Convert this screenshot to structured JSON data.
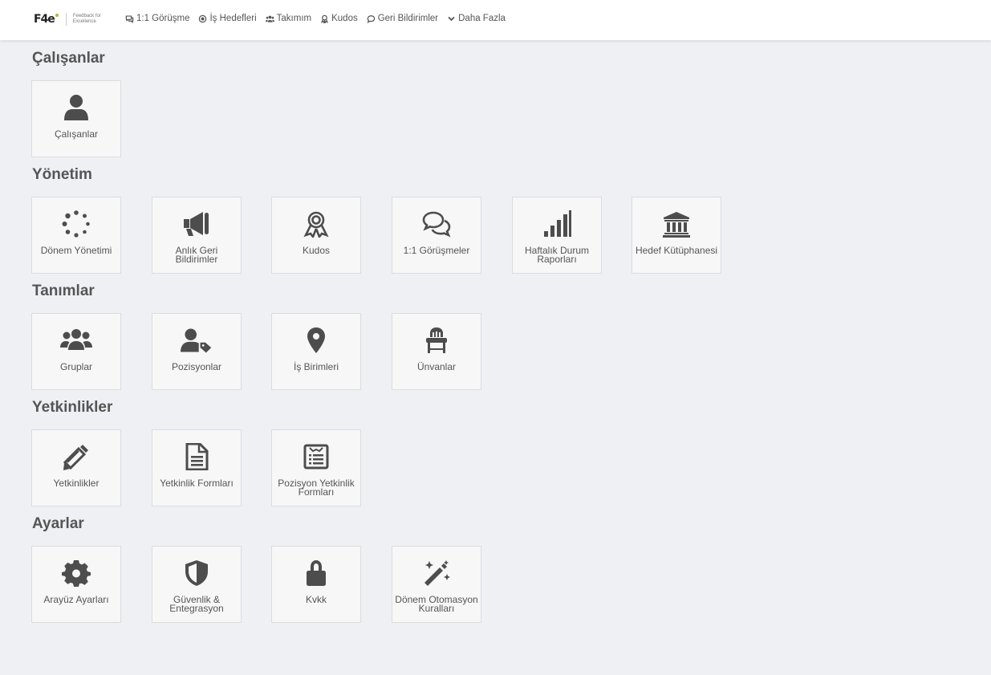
{
  "header": {
    "logo_text": "F4e",
    "logo_subtitle": "Feedback for Excellence",
    "nav": [
      {
        "label": "1:1 Görüşme",
        "icon": "chat-icon"
      },
      {
        "label": "İş Hedefleri",
        "icon": "target-icon"
      },
      {
        "label": "Takımım",
        "icon": "team-icon"
      },
      {
        "label": "Kudos",
        "icon": "award-icon"
      },
      {
        "label": "Geri Bildirimler",
        "icon": "comment-icon"
      },
      {
        "label": "Daha Fazla",
        "icon": "chevron-down-icon"
      }
    ]
  },
  "sections": [
    {
      "title": "Çalışanlar",
      "items": [
        {
          "label": "Çalışanlar",
          "icon": "user-icon"
        }
      ]
    },
    {
      "title": "Yönetim",
      "items": [
        {
          "label": "Dönem Yönetimi",
          "icon": "spinner-icon"
        },
        {
          "label": "Anlık Geri Bildirimler",
          "icon": "megaphone-icon"
        },
        {
          "label": "Kudos",
          "icon": "award-icon"
        },
        {
          "label": "1:1 Görüşmeler",
          "icon": "comments-icon"
        },
        {
          "label": "Haftalık Durum Raporları",
          "icon": "signal-bars-icon"
        },
        {
          "label": "Hedef Kütüphanesi",
          "icon": "library-icon"
        }
      ]
    },
    {
      "title": "Tanımlar",
      "items": [
        {
          "label": "Gruplar",
          "icon": "users-icon"
        },
        {
          "label": "Pozisyonlar",
          "icon": "user-tag-icon"
        },
        {
          "label": "İş Birimleri",
          "icon": "map-marker-icon"
        },
        {
          "label": "Ünvanlar",
          "icon": "chair-icon"
        }
      ]
    },
    {
      "title": "Yetkinlikler",
      "items": [
        {
          "label": "Yetkinlikler",
          "icon": "pencil-icon"
        },
        {
          "label": "Yetkinlik Formları",
          "icon": "file-icon"
        },
        {
          "label": "Pozisyon Yetkinlik Formları",
          "icon": "form-list-icon"
        }
      ]
    },
    {
      "title": "Ayarlar",
      "items": [
        {
          "label": "Arayüz Ayarları",
          "icon": "gear-icon"
        },
        {
          "label": "Güvenlik & Entegrasyon",
          "icon": "shield-icon"
        },
        {
          "label": "Kvkk",
          "icon": "lock-icon"
        },
        {
          "label": "Dönem Otomasyon Kuralları",
          "icon": "magic-wand-icon"
        }
      ]
    }
  ]
}
